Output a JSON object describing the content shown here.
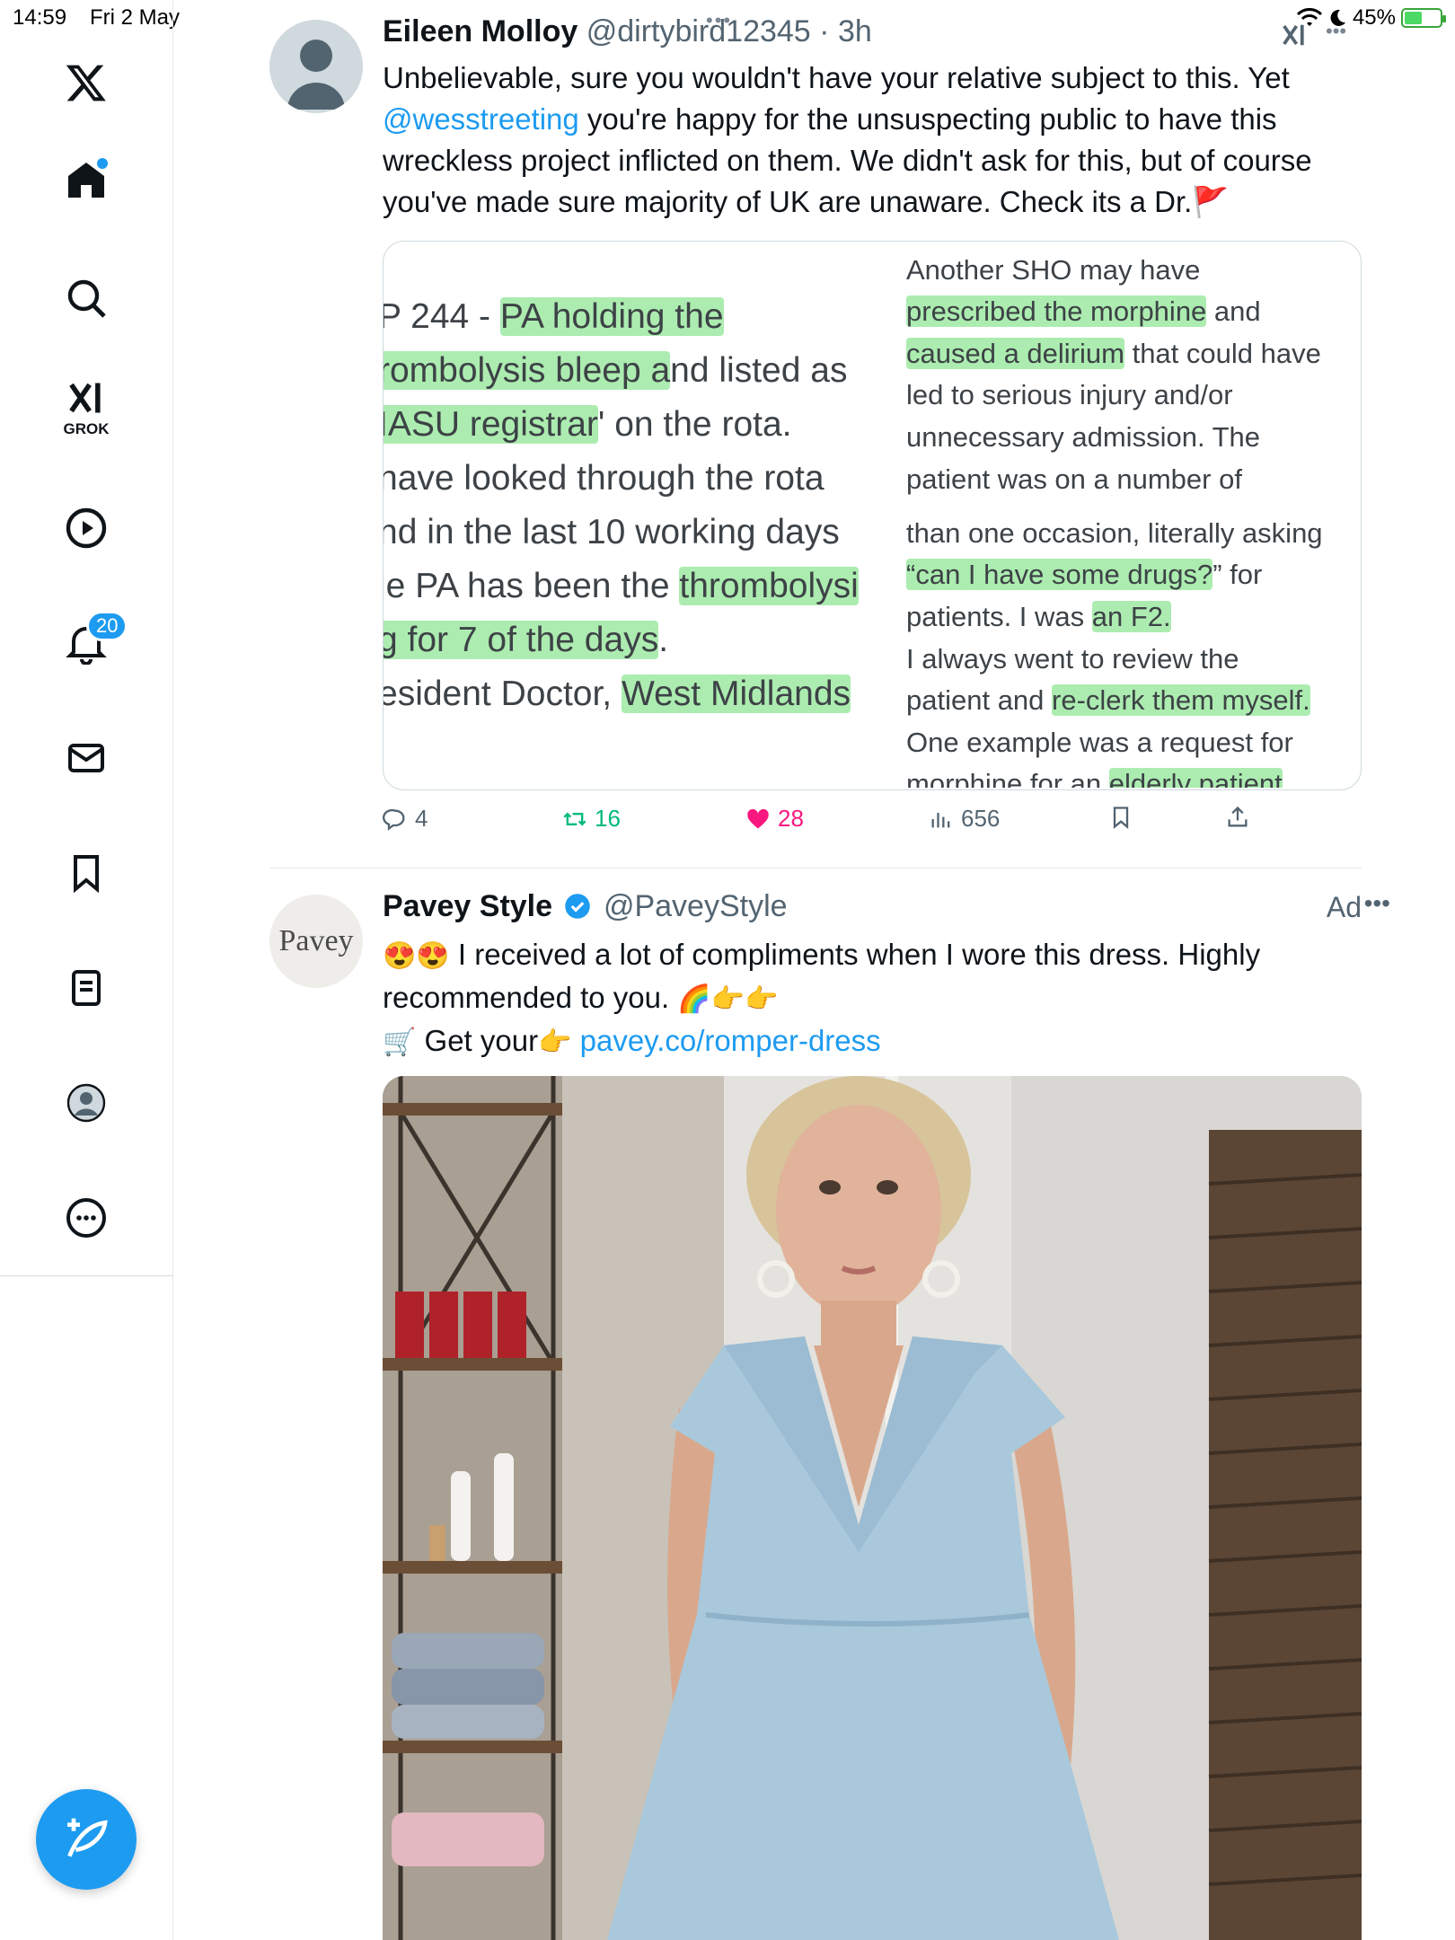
{
  "status_bar": {
    "time": "14:59",
    "date": "Fri 2 May",
    "battery": "45%",
    "battery_level": 0.45
  },
  "sidebar": {
    "items": [
      {
        "name": "x-logo"
      },
      {
        "name": "home"
      },
      {
        "name": "explore"
      },
      {
        "name": "grok",
        "label": "GROK"
      },
      {
        "name": "videos"
      },
      {
        "name": "notifications",
        "count": "20"
      },
      {
        "name": "messages"
      },
      {
        "name": "bookmarks"
      },
      {
        "name": "lists"
      },
      {
        "name": "profile"
      },
      {
        "name": "more"
      }
    ],
    "accent": "#1d9bf0"
  },
  "tweet1": {
    "name": "Eileen Molloy",
    "handle": "@dirtybird12345",
    "time": "· 3h",
    "text_before": "Unbelievable, sure you wouldn't have your relative subject to this. Yet ",
    "mention": "@wesstreeting",
    "text_after": " you're happy for the unsuspecting public to have this wreckless project inflicted on them. We didn't ask for this, but of course you've made sure majority of UK are unaware. Check its a Dr.",
    "emoji": "🚩",
    "image_left": {
      "l1a": "P 244 - ",
      "l1b": "PA holding the",
      "l2a": "rombolysis bleep a",
      "l2b": "nd listed as",
      "l3a": "IASU registrar",
      "l3b": "' on the rota.",
      "l4": "nave looked through the rota",
      "l5": "nd in the last 10 working days",
      "l6a": "ie PA has been the ",
      "l6b": "thrombolysi",
      "l7a": "g for 7 of the days",
      "l7b": ".",
      "l8a": "esident Doctor, ",
      "l8b": "West Midlands"
    },
    "image_right": {
      "r1": "Another SHO may have",
      "r2a": "prescribed the morphine",
      "r2b": " and",
      "r3a": "caused a delirium",
      "r3b": " that could have",
      "r4": "led to serious injury and/or",
      "r5": "unnecessary admission. The",
      "r6": "patient was on a number of",
      "r7": "than one occasion, literally asking",
      "r8a": "“can I have some drugs?",
      "r8b": "” for",
      "r9a": "patients. I was ",
      "r9b": "an F2.",
      "r10": "I always went to review the",
      "r11a": "patient and ",
      "r11b": "re-clerk them myself.",
      "r12": "One example was a request for",
      "r13a": "morphine for an ",
      "r13b": "elderly patient"
    },
    "replies": "4",
    "reposts": "16",
    "likes": "28",
    "views": "656"
  },
  "tweet2": {
    "name": "Pavey Style",
    "handle": "@PaveyStyle",
    "avatar_text": "Pavey",
    "ad_label": "Ad",
    "line1_emoji": "😍😍",
    "line1": " I received a lot of compliments when I wore this dress. Highly",
    "line2": "recommended to you. ",
    "line2_emoji": "🌈👉👉",
    "line3_emoji": "🛒",
    "line3": " Get your",
    "line3_emoji2": "👉",
    "link": "pavey.co/romper-dress"
  }
}
